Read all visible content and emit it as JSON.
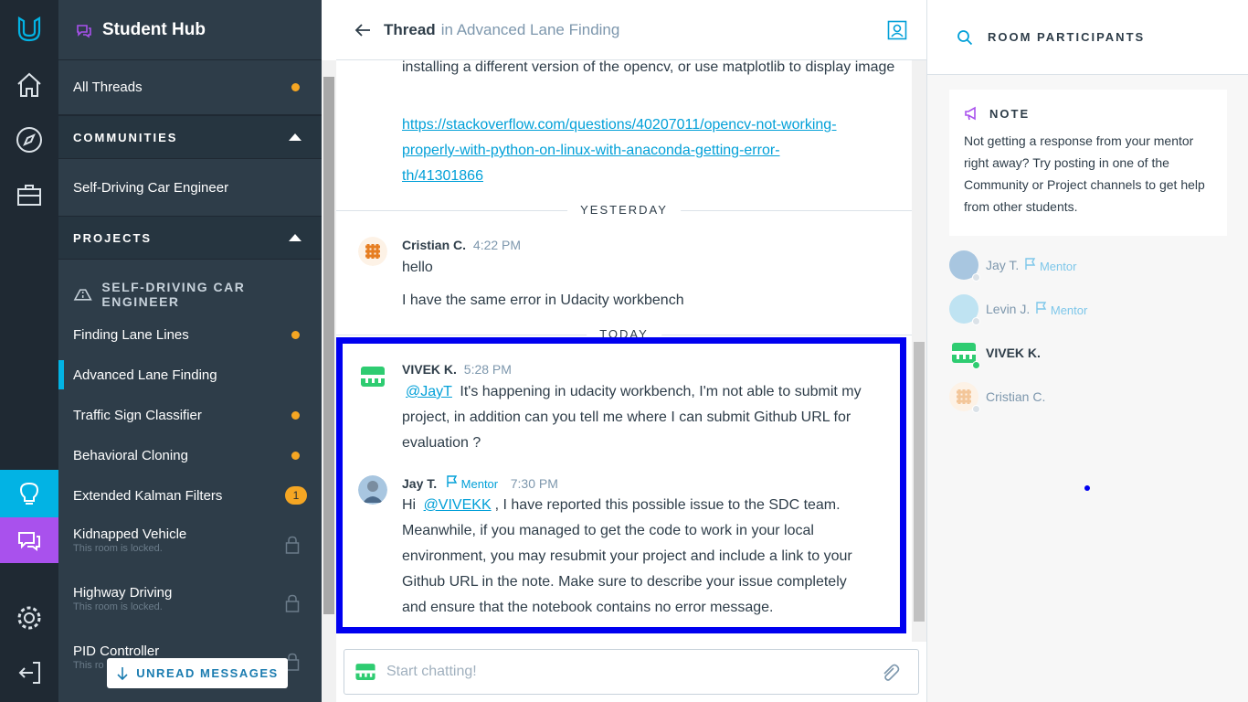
{
  "app": {
    "title": "Student Hub"
  },
  "sidebar": {
    "all_threads": "All Threads",
    "communities_header": "COMMUNITIES",
    "community_items": [
      "Self-Driving Car Engineer"
    ],
    "projects_header": "PROJECTS",
    "program_name": "SELF-DRIVING CAR ENGINEER",
    "projects": [
      {
        "label": "Finding Lane Lines",
        "status": "unread"
      },
      {
        "label": "Advanced Lane Finding",
        "status": "active"
      },
      {
        "label": "Traffic Sign Classifier",
        "status": "unread"
      },
      {
        "label": "Behavioral Cloning",
        "status": "unread"
      },
      {
        "label": "Extended Kalman Filters",
        "badge": "1"
      },
      {
        "label": "Kidnapped Vehicle",
        "sub": "This room is locked.",
        "status": "locked"
      },
      {
        "label": "Highway Driving",
        "sub": "This room is locked.",
        "status": "locked"
      },
      {
        "label": "PID Controller",
        "sub": "This ro",
        "status": "locked"
      }
    ],
    "unread_button": "UNREAD MESSAGES"
  },
  "thread": {
    "title": "Thread",
    "in_text": "in Advanced Lane Finding",
    "partial_text": "installing a different version of the opencv, or use matplotlib to display image",
    "partial_link_lines": [
      "https://stackoverflow.com/questions/40207011/opencv-not-working-",
      "properly-with-python-on-linux-with-anaconda-getting-error-",
      "th/41301866"
    ],
    "sep_yesterday": "YESTERDAY",
    "sep_today": "TODAY",
    "messages": [
      {
        "author": "Cristian C.",
        "time": "4:22 PM",
        "lines": [
          "hello",
          "I have the same error in Udacity workbench"
        ]
      },
      {
        "author": "VIVEK K.",
        "time": "5:28 PM",
        "mention": "@JayT",
        "text_lines": [
          "It's happening in udacity workbench, I'm not able to submit my",
          "project, in addition can you tell me where I can submit Github URL for",
          "evaluation ?"
        ]
      },
      {
        "author": "Jay T.",
        "role": "Mentor",
        "time": "7:30 PM",
        "prefix": "Hi",
        "mention": "@VIVEKK",
        "first_line_rest": ", I have reported this possible issue to the SDC team.",
        "text_lines": [
          "Meanwhile, if you managed to get the code to work in your local",
          "environment, you may resubmit your project and include a link to your",
          "Github URL in the note. Make sure to describe your issue completely",
          "and ensure that the notebook contains no error message."
        ]
      }
    ],
    "composer_placeholder": "Start chatting!"
  },
  "right_panel": {
    "header": "ROOM PARTICIPANTS",
    "note_title": "NOTE",
    "note_body": "Not getting a response from your mentor right away? Try posting in one of the Community or Project channels to get help from other students.",
    "participants": [
      {
        "name": "Jay T.",
        "role": "Mentor"
      },
      {
        "name": "Levin J.",
        "role": "Mentor"
      },
      {
        "name": "VIVEK K.",
        "role": ""
      },
      {
        "name": "Cristian C.",
        "role": ""
      }
    ]
  },
  "colors": {
    "accent": "#02b3e4",
    "highlight": "#0000f0",
    "purple": "#a951ed",
    "green": "#2ecc71",
    "orange": "#f5a623"
  }
}
